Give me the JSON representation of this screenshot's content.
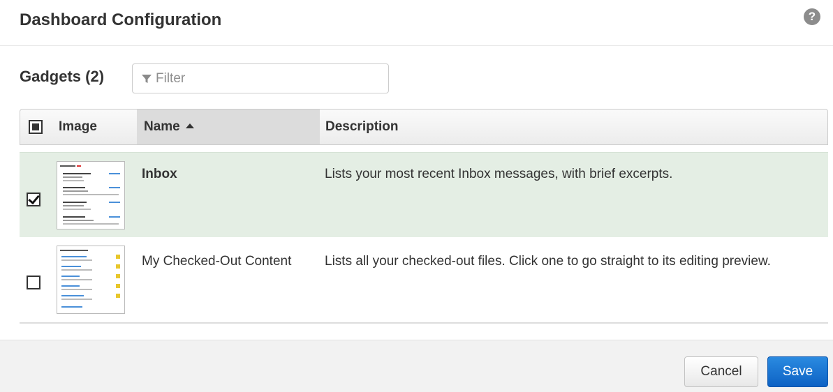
{
  "dialog": {
    "title": "Dashboard Configuration",
    "help_icon": "question-circle-icon"
  },
  "gadgets": {
    "heading": "Gadgets (2)",
    "filter_placeholder": "Filter",
    "filter_value": "",
    "filter_icon": "funnel-icon"
  },
  "table": {
    "columns": {
      "select": "",
      "image": "Image",
      "name": "Name",
      "description": "Description"
    },
    "sort": {
      "column": "Name",
      "direction": "ascending"
    },
    "select_all_state": "partial",
    "rows": [
      {
        "checked": true,
        "name": "Inbox",
        "description": "Lists your most recent Inbox messages, with brief excerpts."
      },
      {
        "checked": false,
        "name": "My Checked-Out Content",
        "description": "Lists all your checked-out files. Click one to go straight to its editing preview."
      }
    ]
  },
  "footer": {
    "cancel_label": "Cancel",
    "save_label": "Save"
  },
  "colors": {
    "selected_row": "#e4eee4",
    "primary_button": "#1a73d6"
  }
}
